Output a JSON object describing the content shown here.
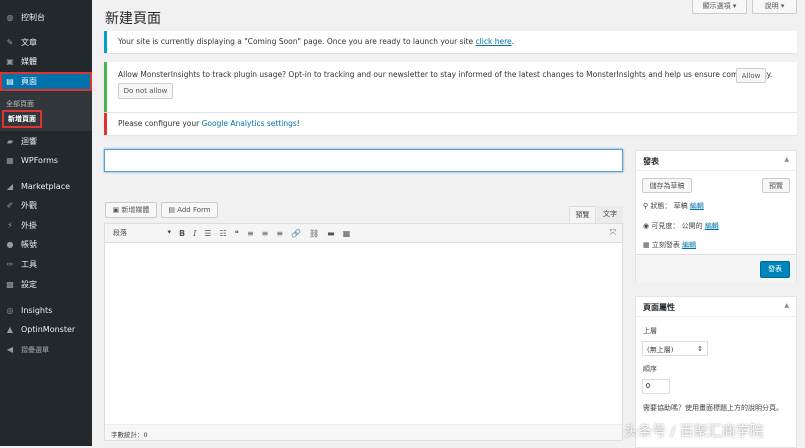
{
  "sidebar": {
    "items": [
      {
        "label": "控制台",
        "icon": "dashboard-icon",
        "g": "◍"
      },
      {
        "label": "文章",
        "icon": "pin-icon",
        "g": "✎"
      },
      {
        "label": "媒體",
        "icon": "media-icon",
        "g": "▣"
      },
      {
        "label": "頁面",
        "icon": "pages-icon",
        "g": "▤"
      },
      {
        "label": "迴響",
        "icon": "comment-icon",
        "g": "▰"
      },
      {
        "label": "WPForms",
        "icon": "forms-icon",
        "g": "▦"
      },
      {
        "label": "Marketplace",
        "icon": "marketplace-icon",
        "g": "◢"
      },
      {
        "label": "外觀",
        "icon": "brush-icon",
        "g": "✐"
      },
      {
        "label": "外掛",
        "icon": "plugin-icon",
        "g": "⚡"
      },
      {
        "label": "帳號",
        "icon": "user-icon",
        "g": "●"
      },
      {
        "label": "工具",
        "icon": "wrench-icon",
        "g": "✑"
      },
      {
        "label": "設定",
        "icon": "settings-icon",
        "g": "▩"
      },
      {
        "label": "Insights",
        "icon": "insights-icon",
        "g": "◎"
      },
      {
        "label": "OptinMonster",
        "icon": "optinmonster-icon",
        "g": "▲"
      },
      {
        "label": "摺疊選單",
        "icon": "collapse-icon",
        "g": "◀"
      }
    ],
    "submenu": [
      "全部頁面",
      "新增頁面"
    ]
  },
  "header": {
    "title": "新建頁面",
    "screen_options": "顯示選項 ▾",
    "help": "說明 ▾"
  },
  "notices": {
    "coming_soon": "Your site is currently displaying a \"Coming Soon\" page. Once you are ready to launch your site ",
    "coming_soon_link": "click here",
    "tracking": "Allow MonsterInsights to track plugin usage? Opt-in to tracking and our newsletter to stay informed of the latest changes to MonsterInsights and help us ensure compatibility.",
    "allow": "Allow",
    "do_not_allow": "Do not allow",
    "ga": "Please configure your ",
    "ga_link": "Google Analytics settings",
    "ga_end": "!"
  },
  "editor": {
    "title_value": "",
    "add_media": "新增媒體",
    "add_form": "Add Form",
    "tab_visual": "預覽",
    "tab_text": "文字",
    "format": "段落",
    "word_count": "字數統計：0",
    "tools": [
      "B",
      "I",
      "☰",
      "☷",
      "❝",
      "≡",
      "≡",
      "≡",
      "🔗",
      "⛓",
      "▬",
      "▦"
    ]
  },
  "publish": {
    "title": "發表",
    "save_draft": "儲存為草稿",
    "preview": "預覽",
    "status_label": "狀態：",
    "status": "草稿",
    "visibility_label": "可見度：",
    "visibility": "公開的",
    "schedule": "立刻發表",
    "edit": "編輯",
    "publish": "發表"
  },
  "attributes": {
    "title": "頁面屬性",
    "parent_label": "上層",
    "parent_value": "(無上層)",
    "order_label": "順序",
    "order_value": "0",
    "help": "需要協助嗎？使用畫面標題上方的說明分頁。"
  },
  "watermark": "头条号 / 百聚汇商学院",
  "colors": {
    "sidebar": "#23282d",
    "accent": "#0073aa",
    "highlight": "#d33"
  }
}
